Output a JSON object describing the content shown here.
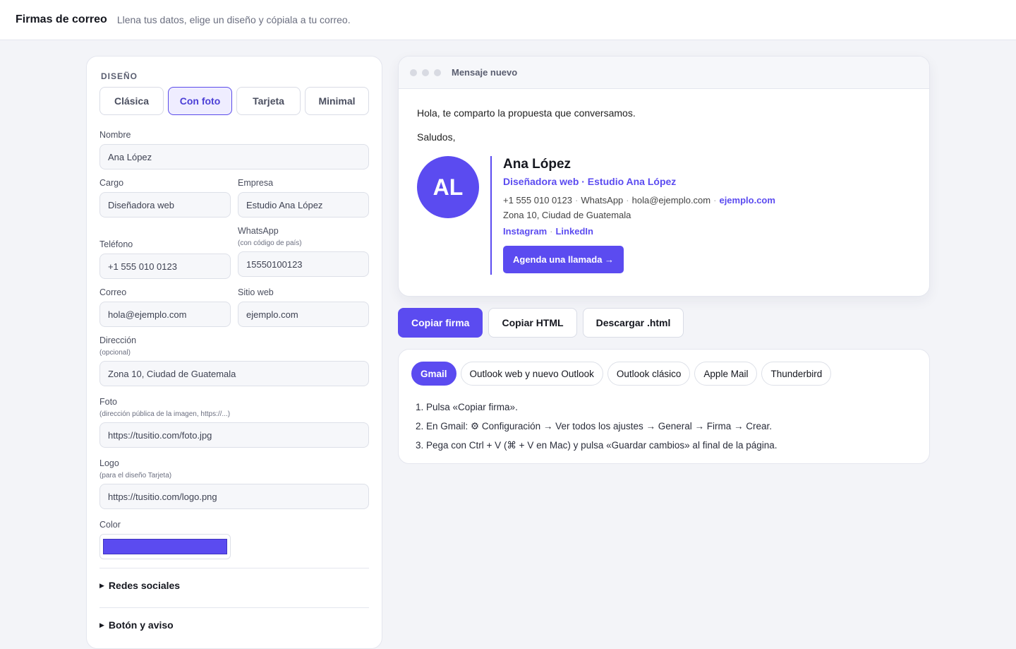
{
  "app": {
    "title": "Firmas de correo",
    "subtitle": "Llena tus datos, elige un diseño y cópiala a tu correo."
  },
  "form": {
    "design_label": "DISEÑO",
    "design_tabs": [
      "Clásica",
      "Con foto",
      "Tarjeta",
      "Minimal"
    ],
    "design_selected": "Con foto",
    "fields": {
      "nombre": {
        "label": "Nombre",
        "value": "Ana López"
      },
      "cargo": {
        "label": "Cargo",
        "value": "Diseñadora web"
      },
      "empresa": {
        "label": "Empresa",
        "value": "Estudio Ana López"
      },
      "telefono": {
        "label": "Teléfono",
        "value": "+1 555 010 0123"
      },
      "whatsapp": {
        "label": "WhatsApp",
        "hint": "(con código de país)",
        "value": "15550100123"
      },
      "correo": {
        "label": "Correo",
        "value": "hola@ejemplo.com"
      },
      "sitio": {
        "label": "Sitio web",
        "value": "ejemplo.com"
      },
      "direccion": {
        "label": "Dirección",
        "hint": "(opcional)",
        "value": "Zona 10, Ciudad de Guatemala"
      },
      "foto": {
        "label": "Foto",
        "hint": "(dirección pública de la imagen, https://...)",
        "placeholder": "https://tusitio.com/foto.jpg"
      },
      "logo": {
        "label": "Logo",
        "hint": "(para el diseño Tarjeta)",
        "placeholder": "https://tusitio.com/logo.png"
      },
      "color": {
        "label": "Color",
        "value": "#5b4bf0"
      }
    },
    "sections": [
      "Redes sociales",
      "Botón y aviso"
    ]
  },
  "preview": {
    "window_title": "Mensaje nuevo",
    "greeting": "Hola, te comparto la propuesta que conversamos.",
    "closing": "Saludos,",
    "signature": {
      "initials": "AL",
      "name": "Ana López",
      "role": "Diseñadora web · Estudio Ana López",
      "phone": "+1 555 010 0123",
      "whatsapp": "WhatsApp",
      "email": "hola@ejemplo.com",
      "website": "ejemplo.com",
      "address": "Zona 10, Ciudad de Guatemala",
      "social": [
        "Instagram",
        "LinkedIn"
      ],
      "cta": "Agenda una llamada →"
    }
  },
  "actions": {
    "copy_signature": "Copiar firma",
    "copy_html": "Copiar HTML",
    "download": "Descargar .html"
  },
  "help": {
    "clients": [
      "Gmail",
      "Outlook web y nuevo Outlook",
      "Outlook clásico",
      "Apple Mail",
      "Thunderbird"
    ],
    "selected_client": "Gmail",
    "steps": [
      "1. Pulsa «Copiar firma».",
      "2. En Gmail: ⚙ Configuración → Ver todos los ajustes → General → Firma → Crear.",
      "3. Pega con Ctrl + V (⌘ + V en Mac) y pulsa «Guardar cambios» al final de la página."
    ]
  }
}
